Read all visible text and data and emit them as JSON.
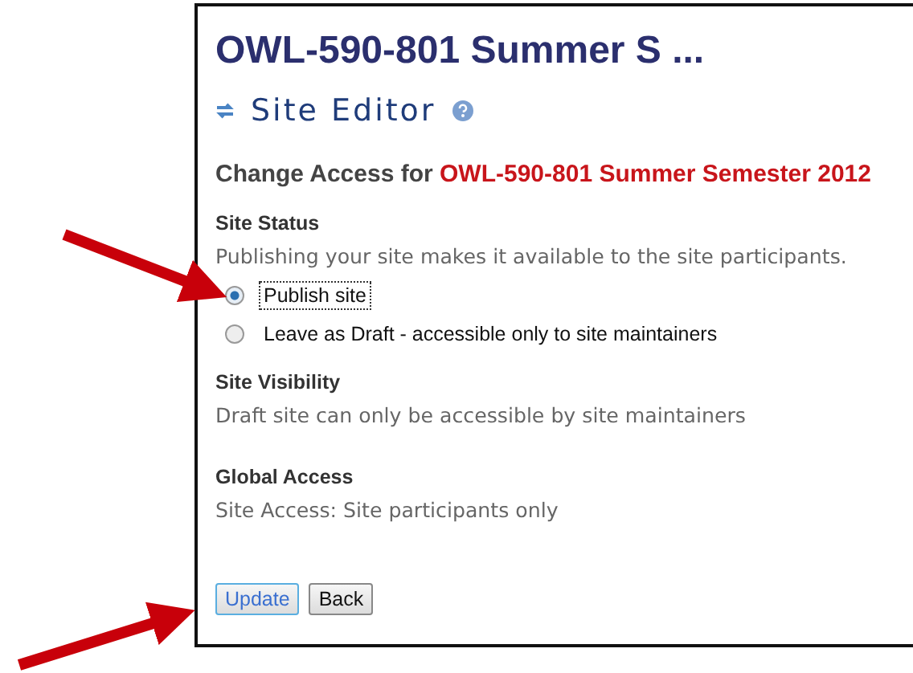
{
  "page_title": "OWL-590-801 Summer S ...",
  "tool_title": "Site Editor",
  "heading": {
    "label": "Change Access for",
    "site_name": "OWL-590-801 Summer Semester 2012"
  },
  "site_status": {
    "title": "Site Status",
    "description": "Publishing your site makes it available to the site participants.",
    "options": [
      {
        "label": "Publish site",
        "selected": true
      },
      {
        "label": "Leave as Draft - accessible only to site maintainers",
        "selected": false
      }
    ]
  },
  "site_visibility": {
    "title": "Site Visibility",
    "description": "Draft site can only be accessible by site maintainers"
  },
  "global_access": {
    "title": "Global Access",
    "description": "Site Access: Site participants only"
  },
  "buttons": [
    {
      "label": "Update",
      "kind": "primary"
    },
    {
      "label": "Back",
      "kind": "secondary"
    }
  ]
}
